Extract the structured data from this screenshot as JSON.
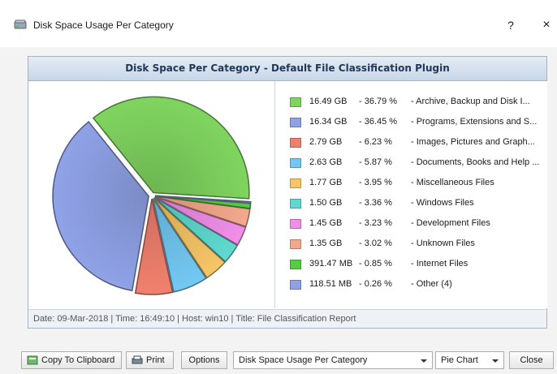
{
  "window": {
    "title": "Disk Space Usage Per Category",
    "help_label": "?",
    "close_label": "×"
  },
  "panel": {
    "title": "Disk Space Per Category - Default File Classification Plugin",
    "footer": "Date: 09-Mar-2018 | Time: 16:49:10 | Host: win10 | Title: File Classification Report"
  },
  "chart_data": {
    "type": "pie",
    "title": "Disk Space Per Category - Default File Classification Plugin",
    "categories": [
      "Archive, Backup and Disk I...",
      "Programs, Extensions and S...",
      "Images, Pictures and Graph...",
      "Documents, Books and Help ...",
      "Miscellaneous Files",
      "Windows Files",
      "Development Files",
      "Unknown Files",
      "Internet Files",
      "Other (4)"
    ],
    "values": [
      36.79,
      36.45,
      6.23,
      5.87,
      3.95,
      3.36,
      3.23,
      3.02,
      0.85,
      0.26
    ],
    "sizes": [
      "16.49 GB",
      "16.34 GB",
      "2.79 GB",
      "2.63 GB",
      "1.77 GB",
      "1.50 GB",
      "1.45 GB",
      "1.35 GB",
      "391.47 MB",
      "118.51 MB"
    ],
    "percent_labels": [
      "- 36.79 %",
      "- 36.45 %",
      "- 6.23 %",
      "- 5.87 %",
      "- 3.95 %",
      "- 3.36 %",
      "- 3.23 %",
      "- 3.02 %",
      "- 0.85 %",
      "- 0.26 %"
    ],
    "name_labels": [
      "- Archive, Backup and Disk I...",
      "- Programs, Extensions and S...",
      "- Images, Pictures and Graph...",
      "- Documents, Books and Help ...",
      "- Miscellaneous Files",
      "- Windows Files",
      "- Development Files",
      "- Unknown Files",
      "- Internet Files",
      "- Other (4)"
    ],
    "colors": [
      "#7fd45f",
      "#8fa2e6",
      "#f0806e",
      "#72c8f2",
      "#f5c566",
      "#5fd9cf",
      "#f08ee8",
      "#f3a88c",
      "#55cc44",
      "#8fa2e6"
    ],
    "exploded": true,
    "legend_position": "right"
  },
  "buttons": {
    "copy": "Copy To Clipboard",
    "print": "Print",
    "options": "Options",
    "report_select": "Disk Space Usage Per Category",
    "chart_type_select": "Pie Chart",
    "close": "Close"
  }
}
